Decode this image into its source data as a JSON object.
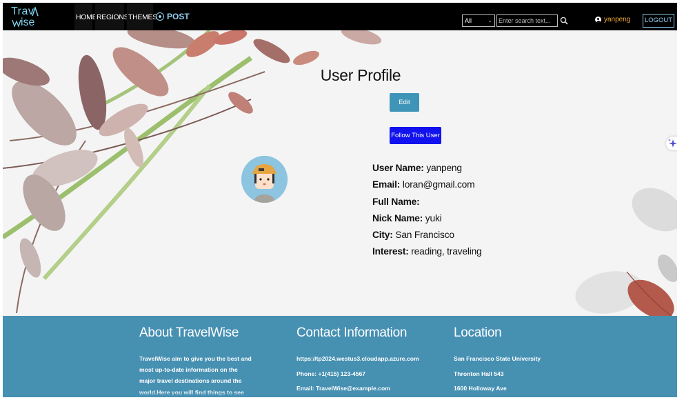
{
  "navbar": {
    "logo_line1": "Trav",
    "logo_line2": "ise",
    "links": {
      "home": "HOME",
      "regions": "REGIONS",
      "themes": "THEMES"
    },
    "post_label": "POST",
    "search": {
      "category": "All",
      "placeholder": "Enter search text..."
    },
    "username": "yanpeng",
    "logout_label": "LOGOUT"
  },
  "profile": {
    "title": "User Profile",
    "edit_label": "Edit",
    "follow_label": "Follow This User",
    "fields": [
      {
        "label": "User Name:",
        "value": "yanpeng"
      },
      {
        "label": "Email:",
        "value": "loran@gmail.com"
      },
      {
        "label": "Full Name:",
        "value": ""
      },
      {
        "label": "Nick Name:",
        "value": "yuki"
      },
      {
        "label": "City:",
        "value": "San Francisco"
      },
      {
        "label": "Interest:",
        "value": "reading, traveling"
      }
    ]
  },
  "footer": {
    "about": {
      "heading": "About TravelWise",
      "text": "TravelWise aim to give you the best and most up-to-date information on the major travel destinations around the world.Here you will find things to see and do,"
    },
    "contact": {
      "heading": "Contact Information",
      "lines": [
        "https://tp2024.westus3.cloudapp.azure.com",
        "Phone: +1(415) 123-4567",
        "Email: TravelWise@example.com"
      ]
    },
    "location": {
      "heading": "Location",
      "lines": [
        "San Francisco State University",
        "Thronton Hall 543",
        "1600 Holloway Ave"
      ]
    }
  },
  "colors": {
    "navbar": "#000000",
    "accent": "#8fd0f0",
    "username": "#f2a93b",
    "edit_button": "#3f95b8",
    "follow_button": "#1212ee",
    "footer": "#4690b2"
  }
}
